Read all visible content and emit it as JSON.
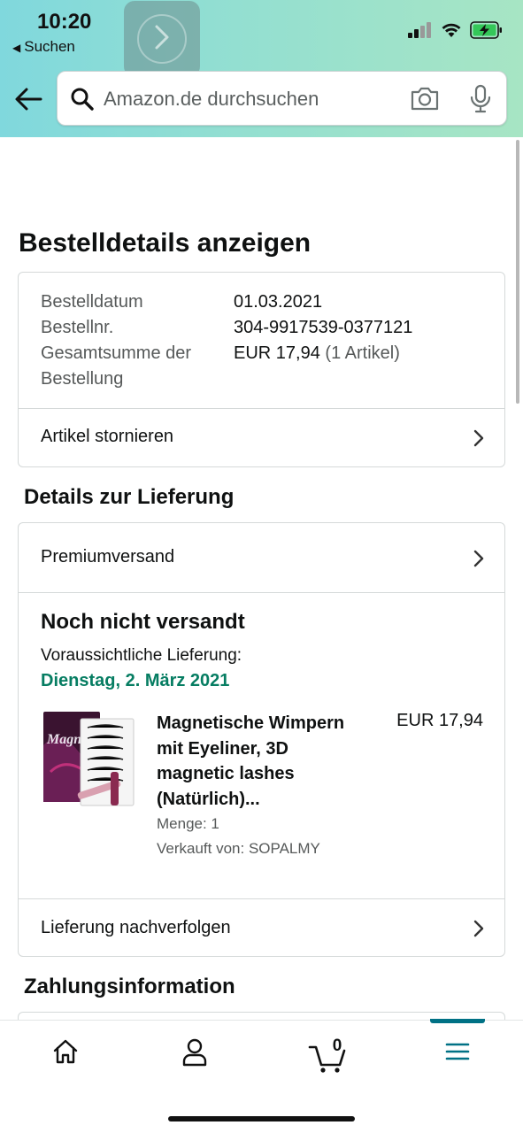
{
  "status_bar": {
    "time": "10:20",
    "back_app_label": "Suchen",
    "signal_icon": "cellular-signal-icon",
    "wifi_icon": "wifi-icon",
    "battery_icon": "battery-charging-icon",
    "battery_color": "#34c759"
  },
  "header": {
    "back_icon": "back-arrow-icon",
    "search": {
      "placeholder": "Amazon.de durchsuchen",
      "camera_icon": "camera-icon",
      "mic_icon": "microphone-icon"
    },
    "forward_icon": "chevron-right-icon"
  },
  "page": {
    "title": "Bestelldetails anzeigen"
  },
  "order_summary": {
    "date_label": "Bestelldatum",
    "date_value": "01.03.2021",
    "number_label": "Bestellnr.",
    "number_value": "304-9917539-0377121",
    "total_label_line1": "Gesamtsumme der",
    "total_label_line2": "Bestellung",
    "total_value": "EUR 17,94",
    "total_items": "(1 Artikel)",
    "cancel_label": "Artikel stornieren"
  },
  "delivery": {
    "section_title": "Details zur Lieferung",
    "shipping_method": "Premiumversand",
    "status": "Noch nicht versandt",
    "expected_label": "Voraussichtliche Lieferung:",
    "expected_date": "Dienstag, 2. März 2021",
    "date_color": "#067d62",
    "product": {
      "title_lines": [
        "Magnetische Wimpern",
        "mit Eyeliner, 3D",
        "magnetic lashes",
        "(Natürlich)..."
      ],
      "price": "EUR 17,94",
      "quantity": "Menge: 1",
      "seller": "Verkauft von: SOPALMY",
      "image_box_text": "Magne"
    },
    "track_label": "Lieferung nachverfolgen"
  },
  "payment": {
    "section_title": "Zahlungsinformation"
  },
  "bottom_nav": {
    "home_icon": "home-icon",
    "account_icon": "person-icon",
    "cart_icon": "cart-icon",
    "cart_count": "0",
    "menu_icon": "hamburger-menu-icon",
    "active_color": "#007185"
  }
}
